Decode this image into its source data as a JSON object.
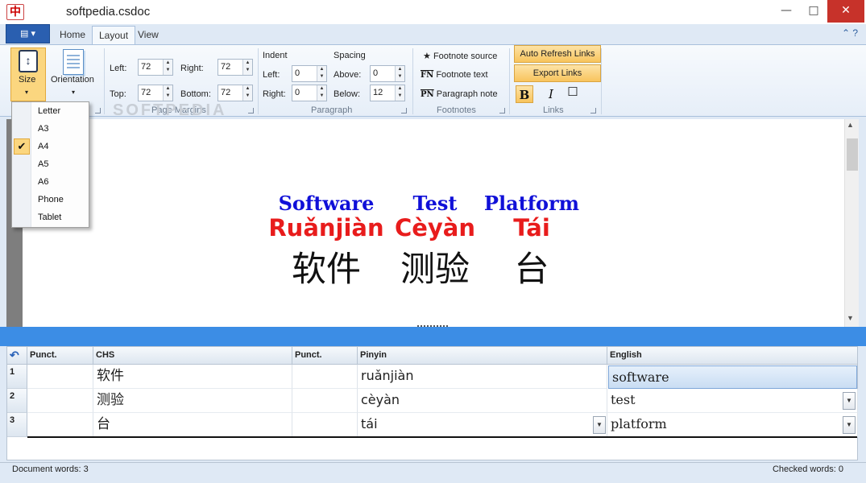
{
  "window": {
    "title": "softpedia.csdoc",
    "icon_glyph": "中",
    "minimize": "—",
    "maximize": "□",
    "close": "✕"
  },
  "tabs": {
    "home": "Home",
    "layout": "Layout",
    "view": "View",
    "file_glyph": "▤ ▾",
    "help_glyphs": "⌃ ?"
  },
  "ribbon": {
    "size_label": "Size",
    "orientation_label": "Orientation",
    "page_margins": {
      "group": "Page Margins",
      "left_label": "Left:",
      "left": "72",
      "right_label": "Right:",
      "right": "72",
      "top_label": "Top:",
      "top": "72",
      "bottom_label": "Bottom:",
      "bottom": "72"
    },
    "paragraph": {
      "group": "Paragraph",
      "indent_label": "Indent",
      "spacing_label": "Spacing",
      "left_label": "Left:",
      "left": "0",
      "right_label": "Right:",
      "right": "0",
      "above_label": "Above:",
      "above": "0",
      "below_label": "Below:",
      "below": "12"
    },
    "footnotes": {
      "group": "Footnotes",
      "source": "Footnote source",
      "text": "Footnote text",
      "note": "Paragraph note",
      "source_glyph": "★",
      "fn_glyph": "FN",
      "pn_glyph": "PN"
    },
    "links": {
      "group": "Links",
      "auto_refresh": "Auto Refresh Links",
      "export": "Export Links",
      "bold": "B",
      "italic": "I",
      "box": "☐"
    }
  },
  "size_menu": {
    "items": [
      "Letter",
      "A3",
      "A4",
      "A5",
      "A6",
      "Phone",
      "Tablet"
    ],
    "selected": "A4",
    "check": "✔"
  },
  "document": {
    "words": [
      {
        "en": "Software",
        "pinyin": "Ruǎnjiàn",
        "chs": "软件"
      },
      {
        "en": "Test",
        "pinyin": "Cèyàn",
        "chs": "测验"
      },
      {
        "en": "Platform",
        "pinyin": "Tái",
        "chs": "台"
      }
    ],
    "colors": {
      "english": "#1010d8",
      "pinyin": "#e81c1c",
      "chinese": "#111111"
    }
  },
  "grid": {
    "headers": [
      "Punct.",
      "CHS",
      "Punct.",
      "Pinyin",
      "English"
    ],
    "rows": [
      {
        "num": "1",
        "punct1": "",
        "chs": "软件",
        "punct2": "",
        "pinyin": "ruǎnjiàn",
        "english": "software"
      },
      {
        "num": "2",
        "punct1": "",
        "chs": "测验",
        "punct2": "",
        "pinyin": "cèyàn",
        "english": "test"
      },
      {
        "num": "3",
        "punct1": "",
        "chs": "台",
        "punct2": "",
        "pinyin": "tái",
        "english": "platform"
      }
    ],
    "undo_glyph": "↶",
    "dropdown_glyph": "▼"
  },
  "status": {
    "left": "Document words: 3",
    "right": "Checked words: 0"
  },
  "watermark": "SOFTPEDIA",
  "scroll": {
    "up": "▲",
    "down": "▼"
  }
}
